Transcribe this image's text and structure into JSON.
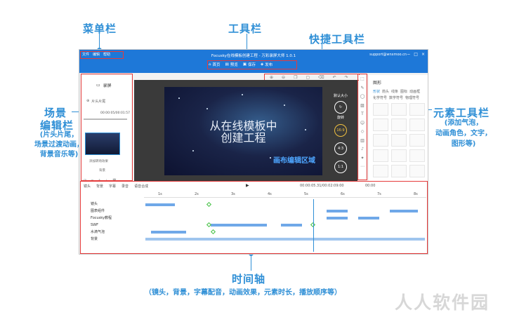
{
  "callouts": {
    "menu_bar": "菜单栏",
    "toolbar": "工具栏",
    "quick_toolbar": "快捷工具栏",
    "scene_editor_line1": "场景",
    "scene_editor_line2": "编辑栏",
    "scene_editor_desc": "(片头片尾，\n场景过渡动画，\n背景音乐等)",
    "element_toolbar": "元素工具栏",
    "element_toolbar_desc": "(添加气泡，\n动画角色，文字，\n图形等)",
    "timeline": "时间轴",
    "timeline_desc": "（镜头，背景，字幕配音，动画效果，元素时长，播放顺序等）"
  },
  "app": {
    "menus": [
      "文件",
      "编辑",
      "帮助"
    ],
    "title": "Focusky在线模板创建工程 - 万彩录屏大师 1.0.1",
    "email": "support@wnxmoo.cn",
    "tools": [
      {
        "icon": "home-icon",
        "label": "首页"
      },
      {
        "icon": "preview-icon",
        "label": "预览"
      },
      {
        "icon": "save-icon",
        "label": "保存"
      },
      {
        "icon": "publish-icon",
        "label": "发布"
      }
    ],
    "scene": {
      "title": "录屏",
      "add_label": "片头片尾",
      "time_label": "00:00:05/00:01:57",
      "transition_label": "添加转场效果",
      "music_label": "背景"
    },
    "canvas": {
      "line1": "从在线模板中",
      "line2": "创建工程",
      "area_label": "画布编辑区域"
    },
    "circles": {
      "c1": "默认大小",
      "c2": "旋转",
      "c3": "16:9",
      "c4": "4:3",
      "c5": "1:1"
    },
    "element_panel": {
      "title": "图形",
      "tabs": [
        "形状",
        "箭头",
        "线条",
        "图标",
        "动画框"
      ],
      "tabs2": [
        "化学符号",
        "数学符号",
        "物理符号"
      ]
    },
    "timeline": {
      "tools": [
        "镜头",
        "背景",
        "字幕",
        "录音",
        "语音合成"
      ],
      "time": "00:00:05.31/00:02:09:00",
      "zoom": "00:00",
      "ticks": [
        "1s",
        "2s",
        "3s",
        "4s",
        "5s",
        "6s",
        "7s",
        "8s"
      ],
      "rows": [
        "镜头",
        "图表组件",
        "Focusky教程",
        "SWF",
        "水滴气泡",
        "背景"
      ]
    }
  },
  "watermark": "人人软件园"
}
